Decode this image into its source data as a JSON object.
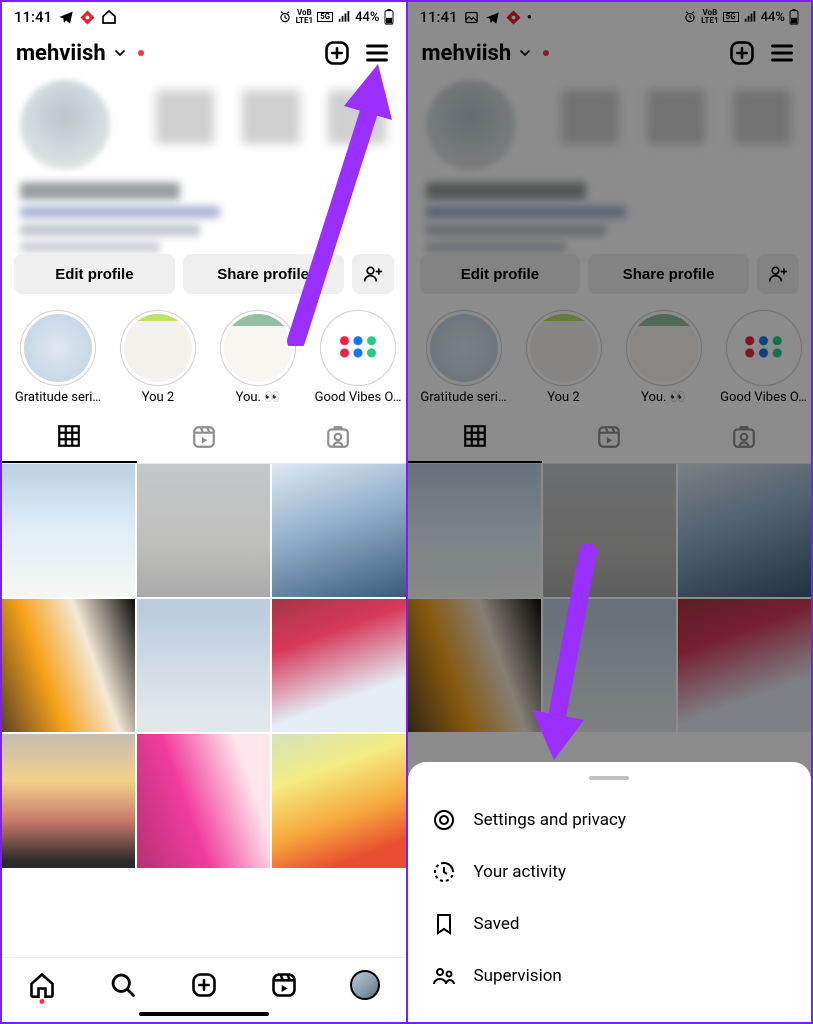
{
  "status": {
    "time": "11:41",
    "battery": "44%",
    "net_l1": "VoB",
    "net_l2": "LTE1",
    "net_r": "5G"
  },
  "header": {
    "username": "mehviish"
  },
  "buttons": {
    "edit": "Edit profile",
    "share": "Share profile"
  },
  "highlights": [
    {
      "label": "Gratitude seri…"
    },
    {
      "label": "You 2"
    },
    {
      "label": "You. 👀"
    },
    {
      "label": "Good Vibes O…"
    }
  ],
  "sheet": {
    "items": [
      {
        "icon": "settings",
        "label": "Settings and privacy"
      },
      {
        "icon": "activity",
        "label": "Your activity"
      },
      {
        "icon": "saved",
        "label": "Saved"
      },
      {
        "icon": "supervision",
        "label": "Supervision"
      }
    ]
  },
  "arrow_color": "#9b2fff"
}
